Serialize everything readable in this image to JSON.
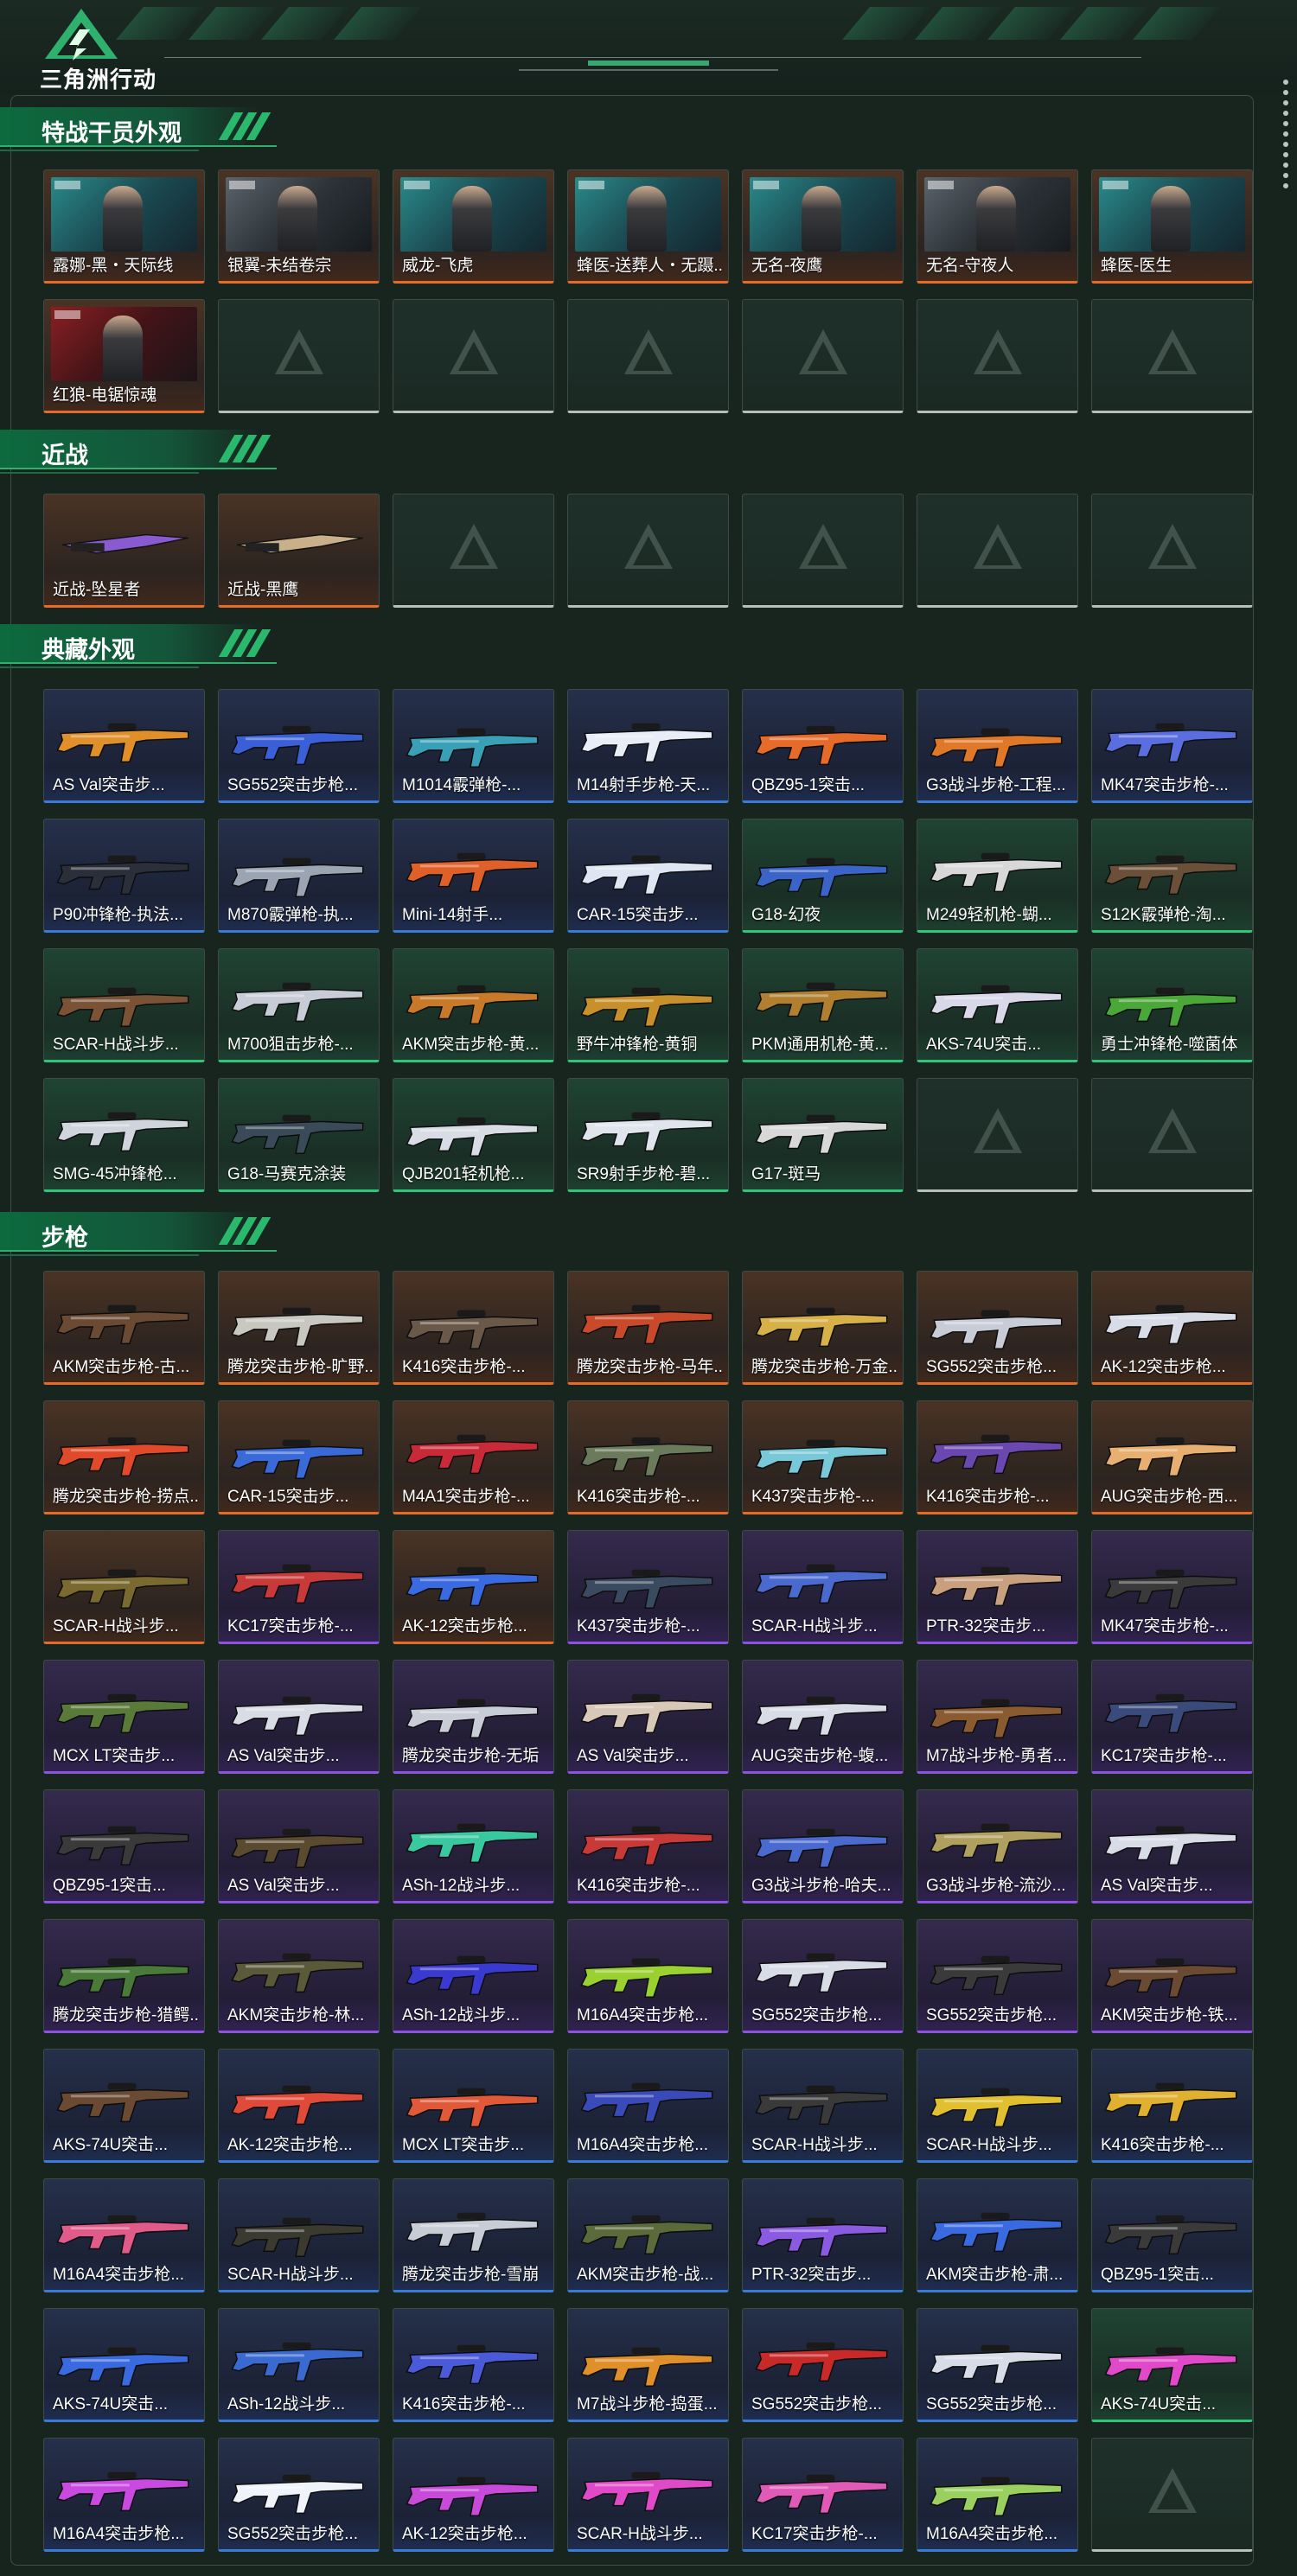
{
  "app": {
    "logo_text": "三角洲行动"
  },
  "colors": {
    "orange": "#e46b2a",
    "blue": "#3a7bd8",
    "green": "#2fc67a",
    "purple": "#8e52e0",
    "empty": "#b7bfbb",
    "accent": "#2fb06c"
  },
  "sections": [
    {
      "title": "特战干员外观",
      "kind": "character",
      "items": [
        {
          "label": "露娜-黑・天际线",
          "rarity": "orange",
          "thumb": "teal"
        },
        {
          "label": "银翼-未结卷宗",
          "rarity": "orange",
          "thumb": "grey"
        },
        {
          "label": "威龙-飞虎",
          "rarity": "orange",
          "thumb": "teal"
        },
        {
          "label": "蜂医-送葬人・无蹑...",
          "rarity": "orange",
          "thumb": "teal"
        },
        {
          "label": "无名-夜鹰",
          "rarity": "orange",
          "thumb": "teal"
        },
        {
          "label": "无名-守夜人",
          "rarity": "orange",
          "thumb": "grey"
        },
        {
          "label": "蜂医-医生",
          "rarity": "orange",
          "thumb": "teal"
        },
        {
          "label": "红狼-电锯惊魂",
          "rarity": "orange",
          "thumb": "red"
        },
        {
          "empty": true
        },
        {
          "empty": true
        },
        {
          "empty": true
        },
        {
          "empty": true
        },
        {
          "empty": true
        },
        {
          "empty": true
        }
      ]
    },
    {
      "title": "近战",
      "kind": "melee",
      "items": [
        {
          "label": "近战-坠星者",
          "rarity": "orange",
          "color": "#8a5ad0"
        },
        {
          "label": "近战-黑鹰",
          "rarity": "orange",
          "color": "#c8b08a"
        },
        {
          "empty": true
        },
        {
          "empty": true
        },
        {
          "empty": true
        },
        {
          "empty": true
        },
        {
          "empty": true
        }
      ]
    },
    {
      "title": "典藏外观",
      "kind": "gun",
      "items": [
        {
          "label": "AS Val突击步...",
          "rarity": "blue",
          "color": "#e0902a"
        },
        {
          "label": "SG552突击步枪...",
          "rarity": "blue",
          "color": "#3b5fd6"
        },
        {
          "label": "M1014霰弹枪-...",
          "rarity": "blue",
          "color": "#3aa0b8"
        },
        {
          "label": "M14射手步枪-天...",
          "rarity": "blue",
          "color": "#e8eef8"
        },
        {
          "label": "QBZ95-1突击...",
          "rarity": "blue",
          "color": "#e66a2a"
        },
        {
          "label": "G3战斗步枪-工程...",
          "rarity": "blue",
          "color": "#e0782a"
        },
        {
          "label": "MK47突击步枪-...",
          "rarity": "blue",
          "color": "#5a6ee0"
        },
        {
          "label": "P90冲锋枪-执法...",
          "rarity": "blue",
          "color": "#2a2f3a"
        },
        {
          "label": "M870霰弹枪-执...",
          "rarity": "blue",
          "color": "#9aa4b2"
        },
        {
          "label": "Mini-14射手...",
          "rarity": "blue",
          "color": "#e0602a"
        },
        {
          "label": "CAR-15突击步...",
          "rarity": "blue",
          "color": "#dde6f2"
        },
        {
          "label": "G18-幻夜",
          "rarity": "green",
          "color": "#3b64c8"
        },
        {
          "label": "M249轻机枪-蝴...",
          "rarity": "green",
          "color": "#d8d8d8"
        },
        {
          "label": "S12K霰弹枪-淘...",
          "rarity": "green",
          "color": "#6a5038"
        },
        {
          "label": "SCAR-H战斗步...",
          "rarity": "green",
          "color": "#7a5236"
        },
        {
          "label": "M700狙击步枪-...",
          "rarity": "green",
          "color": "#c8ccd6"
        },
        {
          "label": "AKM突击步枪-黄...",
          "rarity": "green",
          "color": "#c87a2a"
        },
        {
          "label": "野牛冲锋枪-黄铜",
          "rarity": "green",
          "color": "#c8902a"
        },
        {
          "label": "PKM通用机枪-黄...",
          "rarity": "green",
          "color": "#b08030"
        },
        {
          "label": "AKS-74U突击...",
          "rarity": "green",
          "color": "#d8d8e8"
        },
        {
          "label": "勇士冲锋枪-噬菌体",
          "rarity": "green",
          "color": "#4aa838"
        },
        {
          "label": "SMG-45冲锋枪...",
          "rarity": "green",
          "color": "#d0d4dc"
        },
        {
          "label": "G18-马赛克涂装",
          "rarity": "green",
          "color": "#3a4a58"
        },
        {
          "label": "QJB201轻机枪...",
          "rarity": "green",
          "color": "#d8dce4"
        },
        {
          "label": "SR9射手步枪-碧...",
          "rarity": "green",
          "color": "#e0e4ec"
        },
        {
          "label": "G17-斑马",
          "rarity": "green",
          "color": "#d8d8d8"
        },
        {
          "empty": true
        },
        {
          "empty": true
        }
      ]
    },
    {
      "title": "步枪",
      "kind": "gun",
      "items": [
        {
          "label": "AKM突击步枪-古...",
          "rarity": "orange",
          "color": "#6a4a32"
        },
        {
          "label": "腾龙突击步枪-旷野...",
          "rarity": "orange",
          "color": "#c8c8c0"
        },
        {
          "label": "K416突击步枪-...",
          "rarity": "orange",
          "color": "#6a5848"
        },
        {
          "label": "腾龙突击步枪-马年...",
          "rarity": "orange",
          "color": "#c84a2a"
        },
        {
          "label": "腾龙突击步枪-万金...",
          "rarity": "orange",
          "color": "#d8b048"
        },
        {
          "label": "SG552突击步枪...",
          "rarity": "orange",
          "color": "#c8ccd6"
        },
        {
          "label": "AK-12突击步枪...",
          "rarity": "orange",
          "color": "#d8dce6"
        },
        {
          "label": "腾龙突击步枪-捞点...",
          "rarity": "orange",
          "color": "#e04a2a"
        },
        {
          "label": "CAR-15突击步...",
          "rarity": "orange",
          "color": "#3a6ad8"
        },
        {
          "label": "M4A1突击步枪-...",
          "rarity": "orange",
          "color": "#c82a38"
        },
        {
          "label": "K416突击步枪-...",
          "rarity": "orange",
          "color": "#6a7a5a"
        },
        {
          "label": "K437突击步枪-...",
          "rarity": "orange",
          "color": "#78c8d8"
        },
        {
          "label": "K416突击步枪-...",
          "rarity": "orange",
          "color": "#6a48b0"
        },
        {
          "label": "AUG突击步枪-西...",
          "rarity": "orange",
          "color": "#e8b070"
        },
        {
          "label": "SCAR-H战斗步...",
          "rarity": "orange",
          "color": "#7a6a30"
        },
        {
          "label": "KC17突击步枪-...",
          "rarity": "purple",
          "color": "#c83a3a"
        },
        {
          "label": "AK-12突击步枪...",
          "rarity": "orange",
          "color": "#3a6ae0"
        },
        {
          "label": "K437突击步枪-...",
          "rarity": "purple",
          "color": "#3a4a60"
        },
        {
          "label": "SCAR-H战斗步...",
          "rarity": "purple",
          "color": "#4a6ad0"
        },
        {
          "label": "PTR-32突击步...",
          "rarity": "purple",
          "color": "#c8a080"
        },
        {
          "label": "MK47突击步枪-...",
          "rarity": "purple",
          "color": "#3a3a3a"
        },
        {
          "label": "MCX LT突击步...",
          "rarity": "purple",
          "color": "#5a7a3a"
        },
        {
          "label": "AS Val突击步...",
          "rarity": "purple",
          "color": "#d8dce4"
        },
        {
          "label": "腾龙突击步枪-无垢",
          "rarity": "purple",
          "color": "#c8ccd6"
        },
        {
          "label": "AS Val突击步...",
          "rarity": "purple",
          "color": "#d8c8b8"
        },
        {
          "label": "AUG突击步枪-蝮...",
          "rarity": "purple",
          "color": "#d8dce6"
        },
        {
          "label": "M7战斗步枪-勇者...",
          "rarity": "purple",
          "color": "#8a5a30"
        },
        {
          "label": "KC17突击步枪-...",
          "rarity": "purple",
          "color": "#3a4a7a"
        },
        {
          "label": "QBZ95-1突击...",
          "rarity": "purple",
          "color": "#3a3a3a"
        },
        {
          "label": "AS Val突击步...",
          "rarity": "purple",
          "color": "#5a4a30"
        },
        {
          "label": "ASh-12战斗步...",
          "rarity": "purple",
          "color": "#3ac8a0"
        },
        {
          "label": "K416突击步枪-...",
          "rarity": "purple",
          "color": "#c83a3a"
        },
        {
          "label": "G3战斗步枪-哈夫...",
          "rarity": "purple",
          "color": "#4a6ad0"
        },
        {
          "label": "G3战斗步枪-流沙...",
          "rarity": "purple",
          "color": "#b0a060"
        },
        {
          "label": "AS Val突击步...",
          "rarity": "purple",
          "color": "#d8dce6"
        },
        {
          "label": "腾龙突击步枪-猎鳄...",
          "rarity": "purple",
          "color": "#4a7a3a"
        },
        {
          "label": "AKM突击步枪-林...",
          "rarity": "purple",
          "color": "#5a5a3a"
        },
        {
          "label": "ASh-12战斗步...",
          "rarity": "purple",
          "color": "#3a3ad0"
        },
        {
          "label": "M16A4突击步枪...",
          "rarity": "purple",
          "color": "#9ad030"
        },
        {
          "label": "SG552突击步枪...",
          "rarity": "purple",
          "color": "#d8dce6"
        },
        {
          "label": "SG552突击步枪...",
          "rarity": "purple",
          "color": "#3a3a3a"
        },
        {
          "label": "AKM突击步枪-铁...",
          "rarity": "purple",
          "color": "#6a4a32"
        },
        {
          "label": "AKS-74U突击...",
          "rarity": "blue",
          "color": "#6a4a32"
        },
        {
          "label": "AK-12突击步枪...",
          "rarity": "blue",
          "color": "#e04a3a"
        },
        {
          "label": "MCX LT突击步...",
          "rarity": "blue",
          "color": "#e05a3a"
        },
        {
          "label": "M16A4突击步枪...",
          "rarity": "blue",
          "color": "#3a4ab8"
        },
        {
          "label": "SCAR-H战斗步...",
          "rarity": "blue",
          "color": "#3a3a3a"
        },
        {
          "label": "SCAR-H战斗步...",
          "rarity": "blue",
          "color": "#e0c030"
        },
        {
          "label": "K416突击步枪-...",
          "rarity": "blue",
          "color": "#e0b030"
        },
        {
          "label": "M16A4突击步枪...",
          "rarity": "blue",
          "color": "#e05a8a"
        },
        {
          "label": "SCAR-H战斗步...",
          "rarity": "blue",
          "color": "#3a3a30"
        },
        {
          "label": "腾龙突击步枪-雪崩",
          "rarity": "blue",
          "color": "#c8ccd6"
        },
        {
          "label": "AKM突击步枪-战...",
          "rarity": "blue",
          "color": "#5a6a3a"
        },
        {
          "label": "PTR-32突击步...",
          "rarity": "blue",
          "color": "#8a5ae0"
        },
        {
          "label": "AKM突击步枪-肃...",
          "rarity": "blue",
          "color": "#3a6ae0"
        },
        {
          "label": "QBZ95-1突击...",
          "rarity": "blue",
          "color": "#3a3a3a"
        },
        {
          "label": "AKS-74U突击...",
          "rarity": "blue",
          "color": "#3a6ae0"
        },
        {
          "label": "ASh-12战斗步...",
          "rarity": "blue",
          "color": "#3a6ad0"
        },
        {
          "label": "K416突击步枪-...",
          "rarity": "blue",
          "color": "#4a5ad8"
        },
        {
          "label": "M7战斗步枪-捣蛋...",
          "rarity": "blue",
          "color": "#e0902a"
        },
        {
          "label": "SG552突击步枪...",
          "rarity": "blue",
          "color": "#c82a2a"
        },
        {
          "label": "SG552突击步枪...",
          "rarity": "blue",
          "color": "#d8dce6"
        },
        {
          "label": "AKS-74U突击...",
          "rarity": "green",
          "color": "#e04ac8"
        },
        {
          "label": "M16A4突击步枪...",
          "rarity": "blue",
          "color": "#c84ae0"
        },
        {
          "label": "SG552突击步枪...",
          "rarity": "blue",
          "color": "#f0f4fa"
        },
        {
          "label": "AK-12突击步枪...",
          "rarity": "blue",
          "color": "#c84ad8"
        },
        {
          "label": "SCAR-H战斗步...",
          "rarity": "blue",
          "color": "#e04ac8"
        },
        {
          "label": "KC17突击步枪-...",
          "rarity": "blue",
          "color": "#e05ab8"
        },
        {
          "label": "M16A4突击步枪...",
          "rarity": "blue",
          "color": "#9ad060"
        },
        {
          "empty": true
        }
      ]
    }
  ]
}
